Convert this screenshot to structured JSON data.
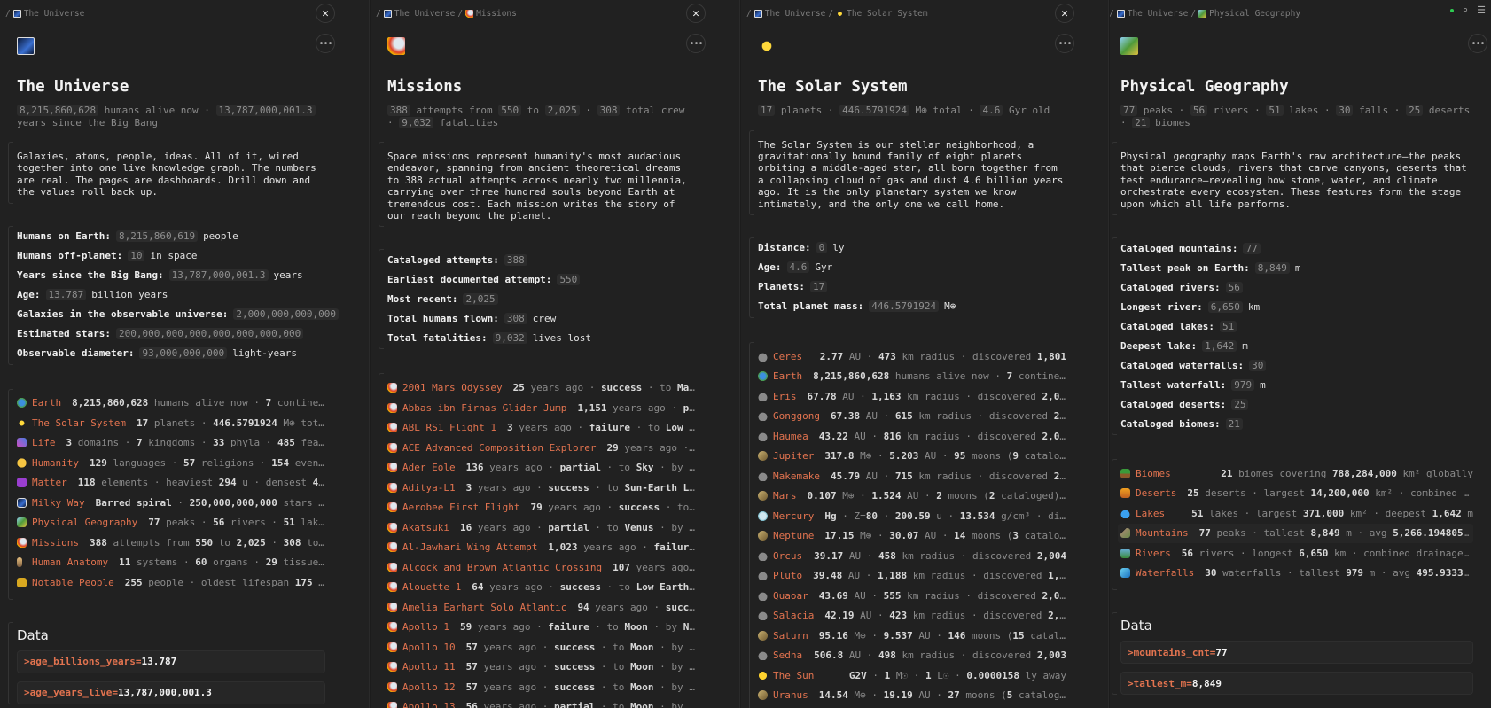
{
  "accent_color": "#e2734f",
  "status_dot_color": "#2ecc52",
  "panels": [
    {
      "breadcrumb": [
        {
          "icon": "galaxy",
          "label": "The Universe"
        }
      ],
      "controls": "close",
      "close_label": "✕",
      "more_label": "•••",
      "icon": "galaxy",
      "title": "The Universe",
      "subtitle": [
        {
          "chip": "8,215,860,628"
        },
        {
          "t": " humans alive now · "
        },
        {
          "chip": "13,787,000,001.3"
        },
        {
          "t": " years since the Big Bang"
        }
      ],
      "description": "Galaxies, atoms, people, ideas. All of it, wired together into one live knowledge graph. The numbers are real. The pages are dashboards. Drill down and the values roll back up.",
      "stats": [
        {
          "label": "Humans on Earth:",
          "value": "8,215,860,619",
          "unit": "people"
        },
        {
          "label": "Humans off-planet:",
          "value": "10",
          "unit": "in space"
        },
        {
          "label": "Years since the Big Bang:",
          "value": "13,787,000,001.3",
          "unit": "years"
        },
        {
          "label": "Age:",
          "value": "13.787",
          "unit": "billion years"
        },
        {
          "label": "Galaxies in the observable universe:",
          "value": "2,000,000,000,000",
          "unit": ""
        },
        {
          "label": "Estimated stars:",
          "value": "200,000,000,000,000,000,000,000",
          "unit": ""
        },
        {
          "label": "Observable diameter:",
          "value": "93,000,000,000",
          "unit": "light-years"
        }
      ],
      "list": [
        {
          "icon": "globe",
          "name": "Earth",
          "desc": "**8,215,860,628** humans alive now · **7** continent…"
        },
        {
          "icon": "sparkles",
          "name": "The Solar System",
          "desc": "**17** planets · **446.5791924** M⊕ total…"
        },
        {
          "icon": "dna",
          "name": "Life",
          "desc": "**3** domains · **7** kingdoms · **33** phyla · **485** featu…"
        },
        {
          "icon": "face",
          "name": "Humanity",
          "desc": "**129** languages · **57** religions · **154** events"
        },
        {
          "icon": "atom",
          "name": "Matter",
          "desc": "**118** elements · heaviest **294** u · densest **41** …"
        },
        {
          "icon": "galaxy",
          "name": "Milky Way",
          "desc": "**Barred spiral** · **250,000,000,000** stars · …"
        },
        {
          "icon": "map",
          "name": "Physical Geography",
          "desc": "**77** peaks · **56** rivers · **51** lakes…"
        },
        {
          "icon": "rocket",
          "name": "Missions",
          "desc": "**388** attempts from **550** to **2,025** · **308** tota…"
        },
        {
          "icon": "person",
          "name": "Human Anatomy",
          "desc": "**11** systems · **60** organs · **29** tissues …"
        },
        {
          "icon": "mask",
          "name": "Notable People",
          "desc": "**255** people · oldest lifespan **175** ye…"
        }
      ],
      "data_heading": "Data",
      "data": [
        {
          "key": ">age_billions_years",
          "eq": " = ",
          "value": "13.787"
        },
        {
          "key": ">age_years_live",
          "eq": " = ",
          "value": "13,787,000,001.3"
        }
      ]
    },
    {
      "breadcrumb": [
        {
          "icon": "galaxy",
          "label": "The Universe"
        },
        {
          "icon": "rocket",
          "label": "Missions"
        }
      ],
      "controls": "close",
      "close_label": "✕",
      "more_label": "•••",
      "icon": "rocket",
      "title": "Missions",
      "subtitle": [
        {
          "chip": "388"
        },
        {
          "t": " attempts from "
        },
        {
          "chip": "550"
        },
        {
          "t": " to "
        },
        {
          "chip": "2,025"
        },
        {
          "t": " · "
        },
        {
          "chip": "308"
        },
        {
          "t": " total crew · "
        },
        {
          "chip": "9,032"
        },
        {
          "t": " fatalities"
        }
      ],
      "description": "Space missions represent humanity's most audacious endeavor, spanning from ancient theoretical dreams to 388 actual attempts across nearly two millennia, carrying over three hundred souls beyond Earth at tremendous cost. Each mission writes the story of our reach beyond the planet.",
      "stats": [
        {
          "label": "Cataloged attempts:",
          "value": "388",
          "unit": ""
        },
        {
          "label": "Earliest documented attempt:",
          "value": "550",
          "unit": ""
        },
        {
          "label": "Most recent:",
          "value": "2,025",
          "unit": ""
        },
        {
          "label": "Total humans flown:",
          "value": "308",
          "unit": "crew"
        },
        {
          "label": "Total fatalities:",
          "value": "9,032",
          "unit": "lives lost"
        }
      ],
      "list": [
        {
          "icon": "rocket",
          "name": "2001 Mars Odyssey",
          "desc": "**25** years ago · **success** · to **Mars…**"
        },
        {
          "icon": "rocket",
          "name": "Abbas ibn Firnas Glider Jump",
          "desc": "**1,151** years ago · **par…**"
        },
        {
          "icon": "rocket",
          "name": "ABL RS1 Flight 1",
          "desc": "**3** years ago · **failure** · to **Low Ea…**"
        },
        {
          "icon": "rocket",
          "name": "ACE Advanced Composition Explorer",
          "desc": "**29** years ago · **s…**"
        },
        {
          "icon": "rocket",
          "name": "Ader Eole",
          "desc": "**136** years ago · **partial** · to **Sky** · by **Cl…**"
        },
        {
          "icon": "rocket",
          "name": "Aditya-L1",
          "desc": "**3** years ago · **success** · to **Sun-Earth L1** …"
        },
        {
          "icon": "rocket",
          "name": "Aerobee First Flight",
          "desc": "**79** years ago · **success** · to **S…**"
        },
        {
          "icon": "rocket",
          "name": "Akatsuki",
          "desc": "**16** years ago · **partial** · to **Venus** · by **JA…**"
        },
        {
          "icon": "rocket",
          "name": "Al-Jawhari Wing Attempt",
          "desc": "**1,023** years ago · **failure** …"
        },
        {
          "icon": "rocket",
          "name": "Alcock and Brown Atlantic Crossing",
          "desc": "**107** years ago ·…"
        },
        {
          "icon": "rocket",
          "name": "Alouette 1",
          "desc": "**64** years ago · **success** · to **Low Earth O…**"
        },
        {
          "icon": "rocket",
          "name": "Amelia Earhart Solo Atlantic",
          "desc": "**94** years ago · **succes…**"
        },
        {
          "icon": "rocket",
          "name": "Apollo 1",
          "desc": "**59** years ago · **failure** · to **Moon** · by **NASA**"
        },
        {
          "icon": "rocket",
          "name": "Apollo 10",
          "desc": "**57** years ago · **success** · to **Moon** · by **NA…**"
        },
        {
          "icon": "rocket",
          "name": "Apollo 11",
          "desc": "**57** years ago · **success** · to **Moon** · by **NA…**"
        },
        {
          "icon": "rocket",
          "name": "Apollo 12",
          "desc": "**57** years ago · **success** · to **Moon** · by **NA…**"
        },
        {
          "icon": "rocket",
          "name": "Apollo 13",
          "desc": "**56** years ago · **partial** · to **Moon** · by **NA…**"
        }
      ]
    },
    {
      "breadcrumb": [
        {
          "icon": "galaxy",
          "label": "The Universe"
        },
        {
          "icon": "sparkles",
          "label": "The Solar System"
        }
      ],
      "controls": "close",
      "close_label": "✕",
      "more_label": "•••",
      "icon": "sparkles",
      "title": "The Solar System",
      "subtitle": [
        {
          "chip": "17"
        },
        {
          "t": " planets · "
        },
        {
          "chip": "446.5791924"
        },
        {
          "t": " M⊕ total · "
        },
        {
          "chip": "4.6"
        },
        {
          "t": " Gyr old"
        }
      ],
      "description": "The Solar System is our stellar neighborhood, a gravitationally bound family of eight planets orbiting a middle-aged star, all born together from a collapsing cloud of gas and dust 4.6 billion years ago. It is the only planetary system we know intimately, and the only one we call home.",
      "stats": [
        {
          "label": "Distance:",
          "value": "0",
          "unit": "ly"
        },
        {
          "label": "Age:",
          "value": "4.6",
          "unit": "Gyr"
        },
        {
          "label": "Planets:",
          "value": "17",
          "unit": ""
        },
        {
          "label": "Total planet mass:",
          "value": "446.5791924",
          "unit": "M⊕"
        }
      ],
      "list": [
        {
          "icon": "rock",
          "name": "Ceres",
          "desc": "**2.77** AU · **473** km radius · discovered **1,801**"
        },
        {
          "icon": "globe",
          "name": "Earth",
          "desc": "**8,215,860,628** humans alive now · **7** continent…"
        },
        {
          "icon": "rock",
          "name": "Eris",
          "desc": "**67.78** AU · **1,163** km radius · discovered **2,005**"
        },
        {
          "icon": "rock",
          "name": "Gonggong",
          "desc": "**67.38** AU · **615** km radius · discovered **2,0…**"
        },
        {
          "icon": "rock",
          "name": "Haumea",
          "desc": "**43.22** AU · **816** km radius · discovered **2,004**"
        },
        {
          "icon": "ringed",
          "name": "Jupiter",
          "desc": "**317.8** M⊕ · **5.203** AU · **95** moons (**9** cataloge…"
        },
        {
          "icon": "rock",
          "name": "Makemake",
          "desc": "**45.79** AU · **715** km radius · discovered **2,0…**"
        },
        {
          "icon": "ringed",
          "name": "Mars",
          "desc": "**0.107** M⊕ · **1.524** AU · **2** moons (**2** cataloged) ·…"
        },
        {
          "icon": "mercury",
          "name": "Mercury",
          "desc": "**Hg** · Z=**80** · **200.59** u · **13.534** g/cm³ · disc…"
        },
        {
          "icon": "ringed",
          "name": "Neptune",
          "desc": "**17.15** M⊕ · **30.07** AU · **14** moons (**3** cataloge…"
        },
        {
          "icon": "rock",
          "name": "Orcus",
          "desc": "**39.17** AU · **458** km radius · discovered **2,004**"
        },
        {
          "icon": "rock",
          "name": "Pluto",
          "desc": "**39.48** AU · **1,188** km radius · discovered **1,930**"
        },
        {
          "icon": "rock",
          "name": "Quaoar",
          "desc": "**43.69** AU · **555** km radius · discovered **2,002**"
        },
        {
          "icon": "rock",
          "name": "Salacia",
          "desc": "**42.19** AU · **423** km radius · discovered **2,004**"
        },
        {
          "icon": "ringed",
          "name": "Saturn",
          "desc": "**95.16** M⊕ · **9.537** AU · **146** moons (**15** catalog…"
        },
        {
          "icon": "rock",
          "name": "Sedna",
          "desc": "**506.8** AU · **498** km radius · discovered **2,003**"
        },
        {
          "icon": "star",
          "name": "The Sun",
          "desc": "**G2V** · **1** M☉ · **1** L☉ · **0.0000158** ly away"
        },
        {
          "icon": "ringed",
          "name": "Uranus",
          "desc": "**14.54** M⊕ · **19.19** AU · **27** moons (**5** cataloged…"
        }
      ]
    },
    {
      "breadcrumb": [
        {
          "icon": "galaxy",
          "label": "The Universe"
        },
        {
          "icon": "map",
          "label": "Physical Geography"
        }
      ],
      "controls": "tools",
      "search_label": "⌕",
      "menu_label": "☰",
      "more_label": "•••",
      "icon": "map",
      "title": "Physical Geography",
      "subtitle": [
        {
          "chip": "77"
        },
        {
          "t": " peaks · "
        },
        {
          "chip": "56"
        },
        {
          "t": " rivers · "
        },
        {
          "chip": "51"
        },
        {
          "t": " lakes · "
        },
        {
          "chip": "30"
        },
        {
          "t": " falls · "
        },
        {
          "chip": "25"
        },
        {
          "t": " deserts · "
        },
        {
          "chip": "21"
        },
        {
          "t": " biomes"
        }
      ],
      "description": "Physical geography maps Earth's raw architecture—the peaks that pierce clouds, rivers that carve canyons, deserts that test endurance—revealing how stone, water, and climate orchestrate every ecosystem. These features form the stage upon which all life performs.",
      "stats": [
        {
          "label": "Cataloged mountains:",
          "value": "77",
          "unit": ""
        },
        {
          "label": "Tallest peak on Earth:",
          "value": "8,849",
          "unit": "m"
        },
        {
          "label": "Cataloged rivers:",
          "value": "56",
          "unit": ""
        },
        {
          "label": "Longest river:",
          "value": "6,650",
          "unit": "km"
        },
        {
          "label": "Cataloged lakes:",
          "value": "51",
          "unit": ""
        },
        {
          "label": "Deepest lake:",
          "value": "1,642",
          "unit": "m"
        },
        {
          "label": "Cataloged waterfalls:",
          "value": "30",
          "unit": ""
        },
        {
          "label": "Tallest waterfall:",
          "value": "979",
          "unit": "m"
        },
        {
          "label": "Cataloged deserts:",
          "value": "25",
          "unit": ""
        },
        {
          "label": "Cataloged biomes:",
          "value": "21",
          "unit": ""
        }
      ],
      "list": [
        {
          "icon": "palm",
          "name": "Biomes",
          "desc": "**21** biomes covering **788,284,000** km² globally"
        },
        {
          "icon": "desert",
          "name": "Deserts",
          "desc": "**25** deserts · largest **14,200,000** km² · combined **47,6…**"
        },
        {
          "icon": "drop",
          "name": "Lakes",
          "desc": "**51** lakes · largest **371,000** km² · deepest **1,642** m"
        },
        {
          "icon": "mountain",
          "name": "Mountains",
          "desc": "**77** peaks · tallest **8,849** m · avg **5,266.19480519** m",
          "highlighted": true
        },
        {
          "icon": "river",
          "name": "Rivers",
          "desc": "**56** rivers · longest **6,650** km · combined drainage **57,…**"
        },
        {
          "icon": "waterfall",
          "name": "Waterfalls",
          "desc": "**30** waterfalls · tallest **979** m · avg **495.93333333…**"
        }
      ],
      "data_heading": "Data",
      "data": [
        {
          "key": ">mountains_cnt",
          "eq": " = ",
          "value": "77"
        },
        {
          "key": ">tallest_m",
          "eq": " = ",
          "value": "8,849"
        }
      ]
    }
  ]
}
